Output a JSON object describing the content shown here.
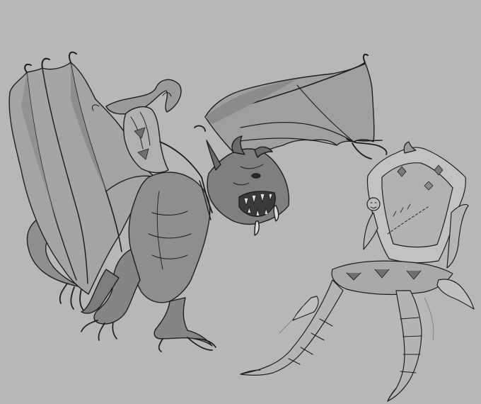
{
  "image": {
    "background": "#b7b7b7",
    "ink": "#1f1f1f",
    "tones": {
      "wing_light": "#a8a8a8",
      "wing_mid": "#9a9a9a",
      "wing_dark": "#7f7f7f",
      "body": "#8c8c8c",
      "body_dark": "#6d6d6d",
      "mouth": "#3a3a3a",
      "chair_light": "#c9c9c9",
      "chair_mid": "#a9a9a9",
      "chair_dark": "#8f8f8f"
    },
    "subjects": [
      {
        "id": "winged-demon-creature",
        "description_icon": "demon-creature-drawing"
      },
      {
        "id": "clawed-throne-chair",
        "description_icon": "throne-chair-drawing"
      }
    ]
  }
}
